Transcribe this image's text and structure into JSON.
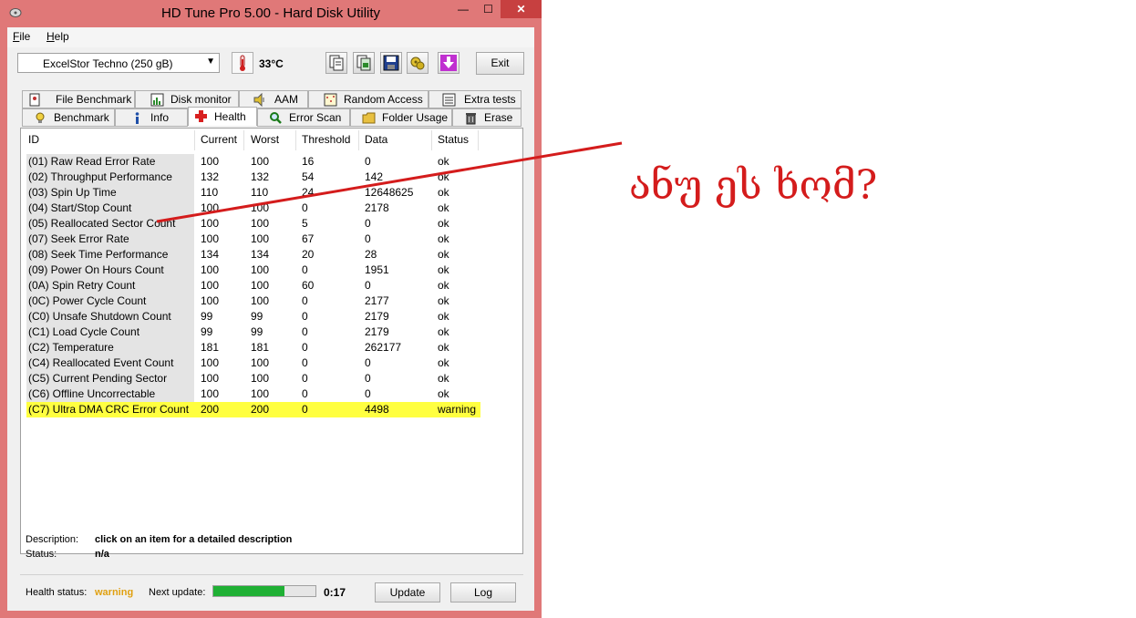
{
  "window": {
    "title": "HD Tune Pro 5.00 - Hard Disk Utility",
    "min_glyph": "—",
    "max_glyph": "☐",
    "close_glyph": "✕"
  },
  "menu": [
    {
      "accel": "F",
      "rest": "ile"
    },
    {
      "accel": "H",
      "rest": "elp"
    }
  ],
  "toolbar": {
    "drive": "ExcelStor Techno (250 gB)",
    "drive_arrow": "▼",
    "temperature": "33°C",
    "icons": [
      "copy-text-icon",
      "copy-screenshot-icon",
      "save-icon",
      "options-icon",
      "download-icon"
    ],
    "exit_label": "Exit"
  },
  "tabs_top": [
    {
      "label": "File Benchmark",
      "icon": "file-benchmark-icon"
    },
    {
      "label": "Disk monitor",
      "icon": "disk-monitor-icon"
    },
    {
      "label": "AAM",
      "icon": "speaker-icon"
    },
    {
      "label": "Random Access",
      "icon": "random-access-icon"
    },
    {
      "label": "Extra tests",
      "icon": "extra-tests-icon"
    }
  ],
  "tabs_bottom": [
    {
      "label": "Benchmark",
      "icon": "benchmark-icon"
    },
    {
      "label": "Info",
      "icon": "info-icon"
    },
    {
      "label": "Health",
      "icon": "health-cross-icon",
      "active": true
    },
    {
      "label": "Error Scan",
      "icon": "magnifier-icon"
    },
    {
      "label": "Folder Usage",
      "icon": "folder-icon"
    },
    {
      "label": "Erase",
      "icon": "trash-icon"
    }
  ],
  "table": {
    "columns": [
      "ID",
      "Current",
      "Worst",
      "Threshold",
      "Data",
      "Status"
    ],
    "rows": [
      [
        "(01) Raw Read Error Rate",
        "100",
        "100",
        "16",
        "0",
        "ok"
      ],
      [
        "(02) Throughput Performance",
        "132",
        "132",
        "54",
        "142",
        "ok"
      ],
      [
        "(03) Spin Up Time",
        "110",
        "110",
        "24",
        "12648625",
        "ok"
      ],
      [
        "(04) Start/Stop Count",
        "100",
        "100",
        "0",
        "2178",
        "ok"
      ],
      [
        "(05) Reallocated Sector Count",
        "100",
        "100",
        "5",
        "0",
        "ok"
      ],
      [
        "(07) Seek Error Rate",
        "100",
        "100",
        "67",
        "0",
        "ok"
      ],
      [
        "(08) Seek Time Performance",
        "134",
        "134",
        "20",
        "28",
        "ok"
      ],
      [
        "(09) Power On Hours Count",
        "100",
        "100",
        "0",
        "1951",
        "ok"
      ],
      [
        "(0A) Spin Retry Count",
        "100",
        "100",
        "60",
        "0",
        "ok"
      ],
      [
        "(0C) Power Cycle Count",
        "100",
        "100",
        "0",
        "2177",
        "ok"
      ],
      [
        "(C0) Unsafe Shutdown Count",
        "99",
        "99",
        "0",
        "2179",
        "ok"
      ],
      [
        "(C1) Load Cycle Count",
        "99",
        "99",
        "0",
        "2179",
        "ok"
      ],
      [
        "(C2) Temperature",
        "181",
        "181",
        "0",
        "262177",
        "ok"
      ],
      [
        "(C4) Reallocated Event Count",
        "100",
        "100",
        "0",
        "0",
        "ok"
      ],
      [
        "(C5) Current Pending Sector",
        "100",
        "100",
        "0",
        "0",
        "ok"
      ],
      [
        "(C6) Offline Uncorrectable",
        "100",
        "100",
        "0",
        "0",
        "ok"
      ],
      [
        "(C7) Ultra DMA CRC Error Count",
        "200",
        "200",
        "0",
        "4498",
        "warning"
      ]
    ],
    "highlight_color": "#ffff40"
  },
  "description": {
    "desc_label": "Description:",
    "desc_value": "click on an item for a detailed description",
    "status_label": "Status:",
    "status_value": "n/a"
  },
  "statusbar": {
    "health_label": "Health status:",
    "health_value": "warning",
    "next_label": "Next update:",
    "progress": 0.7,
    "timer": "0:17",
    "update_label": "Update",
    "log_label": "Log"
  },
  "annotation": {
    "text": "ანუ ეს ხომ?",
    "color": "#d41c1c"
  }
}
